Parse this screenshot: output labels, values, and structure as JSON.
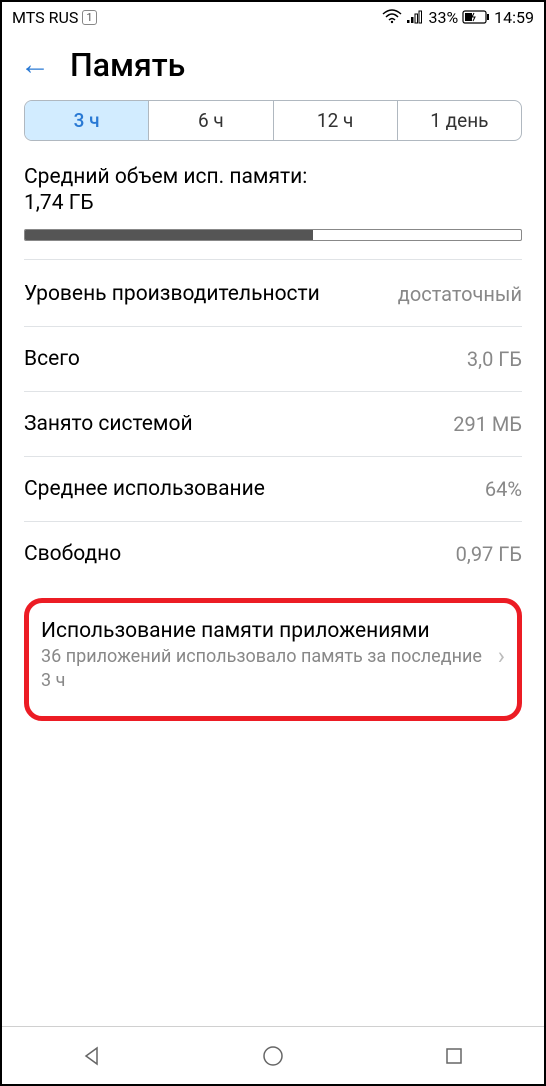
{
  "status": {
    "carrier": "MTS RUS",
    "sim": "1",
    "battery": "33%",
    "time": "14:59"
  },
  "header": {
    "title": "Память"
  },
  "tabs": {
    "t1": "3 ч",
    "t2": "6 ч",
    "t3": "12 ч",
    "t4": "1 день"
  },
  "usage": {
    "label": "Средний объем исп. памяти:",
    "value": "1,74 ГБ",
    "percent": 58
  },
  "rows": {
    "perf": {
      "label": "Уровень производительности",
      "value": "достаточный"
    },
    "total": {
      "label": "Всего",
      "value": "3,0 ГБ"
    },
    "system": {
      "label": "Занято системой",
      "value": "291 МБ"
    },
    "avg": {
      "label": "Среднее использование",
      "value": "64%"
    },
    "free": {
      "label": "Свободно",
      "value": "0,97 ГБ"
    }
  },
  "apps": {
    "title": "Использование памяти приложениями",
    "sub": "36 приложений использовало память за последние 3 ч"
  }
}
